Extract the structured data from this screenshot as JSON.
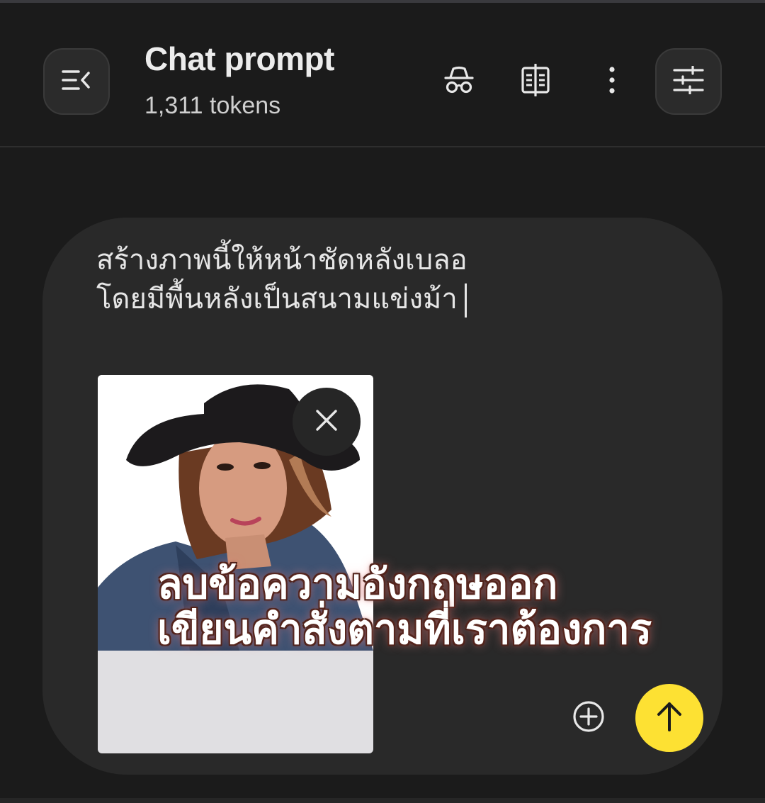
{
  "header": {
    "title": "Chat prompt",
    "token_count": "1,311 tokens"
  },
  "icons": {
    "menu": "menu-collapse-icon",
    "incognito": "incognito-icon",
    "compare": "compare-icon",
    "more": "more-vertical-icon",
    "tune": "tune-icon",
    "remove": "close-icon",
    "add": "add-circle-icon",
    "send": "arrow-up-icon"
  },
  "prompt": {
    "lines": [
      "สร้างภาพนี้ให้หน้าชัดหลังเบลอ",
      "โดยมีพื้นหลังเป็นสนามแข่งม้า"
    ]
  },
  "attachment": {
    "kind": "image"
  },
  "overlay": {
    "lines": [
      "ลบข้อความอังกฤษออก",
      "เขียนคำสั่งตามที่เราต้องการ"
    ]
  },
  "colors": {
    "background": "#1b1b1b",
    "panel": "#292929",
    "send_button": "#fde133",
    "icon": "#e8e8e8"
  }
}
